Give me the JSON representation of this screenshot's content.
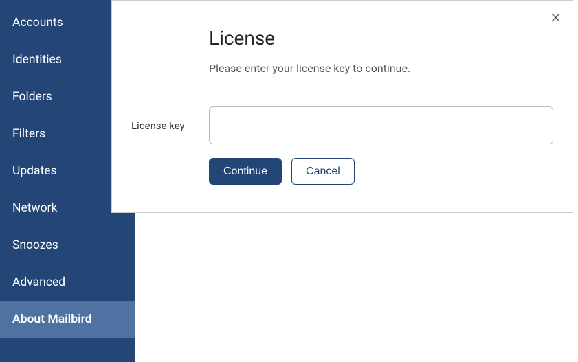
{
  "sidebar": {
    "items": [
      {
        "label": "Accounts"
      },
      {
        "label": "Identities"
      },
      {
        "label": "Folders"
      },
      {
        "label": "Filters"
      },
      {
        "label": "Updates"
      },
      {
        "label": "Network"
      },
      {
        "label": "Snoozes"
      },
      {
        "label": "Advanced"
      },
      {
        "label": "About Mailbird"
      }
    ],
    "activeIndex": 8
  },
  "dialog": {
    "title": "License",
    "subtitle": "Please enter your license key to continue.",
    "label": "License key",
    "value": "",
    "continue_label": "Continue",
    "cancel_label": "Cancel"
  }
}
